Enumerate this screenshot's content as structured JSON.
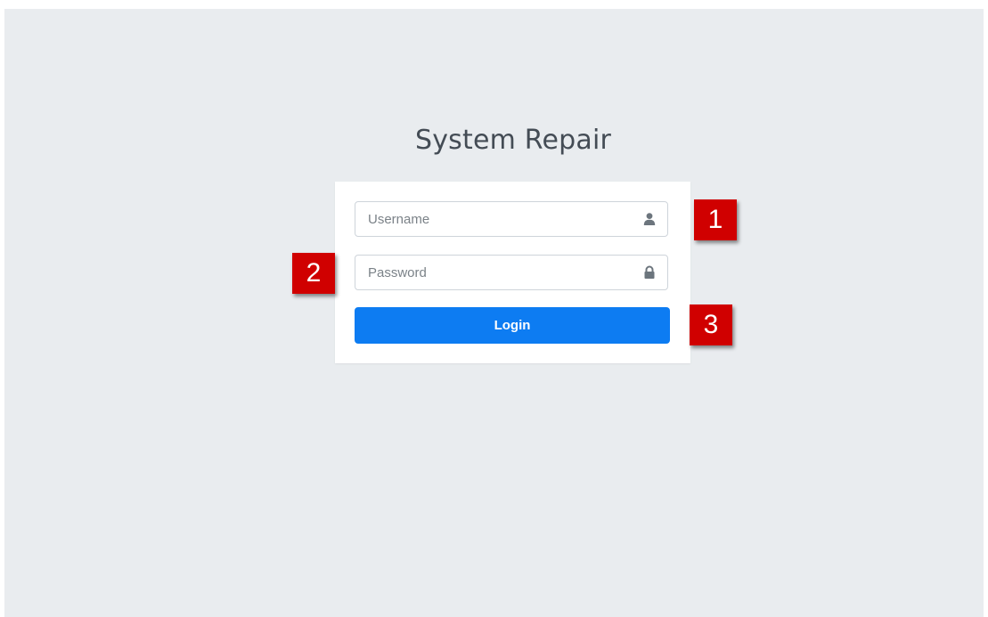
{
  "page": {
    "title": "System Repair"
  },
  "login_form": {
    "username": {
      "placeholder": "Username",
      "value": "",
      "icon": "user-icon"
    },
    "password": {
      "placeholder": "Password",
      "value": "",
      "icon": "lock-icon"
    },
    "login_button_label": "Login"
  },
  "annotations": {
    "callout_1": "1",
    "callout_2": "2",
    "callout_3": "3"
  },
  "colors": {
    "background": "#e9ecef",
    "button": "#0d7cf2",
    "callout": "#d00000"
  }
}
